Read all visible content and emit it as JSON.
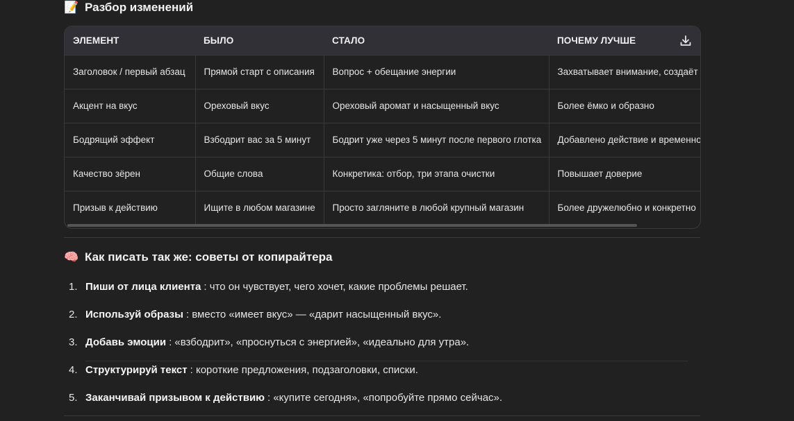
{
  "section1": {
    "emoji": "📝",
    "title": "Разбор изменений"
  },
  "table": {
    "headers": [
      "ЭЛЕМЕНТ",
      "БЫЛО",
      "СТАЛО",
      "ПОЧЕМУ ЛУЧШЕ"
    ],
    "rows": [
      [
        "Заголовок / первый абзац",
        "Прямой старт с описания",
        "Вопрос + обещание энергии",
        "Захватывает внимание, создаёт л"
      ],
      [
        "Акцент на вкус",
        "Ореховый вкус",
        "Ореховый аромат и насыщенный вкус",
        "Более ёмко и образно"
      ],
      [
        "Бодрящий эффект",
        "Взбодрит вас за 5 минут",
        "Бодрит уже через 5 минут после первого глотка",
        "Добавлено действие и временно"
      ],
      [
        "Качество зёрен",
        "Общие слова",
        "Конкретика: отбор, три этапа очистки",
        "Повышает доверие"
      ],
      [
        "Призыв к действию",
        "Ищите в любом магазине",
        "Просто загляните в любой крупный магазин",
        "Более дружелюбно и конкретно"
      ]
    ],
    "download_icon": "download-icon"
  },
  "section2": {
    "emoji": "🧠",
    "title": "Как писать так же: советы от копирайтера"
  },
  "tips": [
    {
      "num": "1.",
      "bold": "Пиши от лица клиента",
      "text": ": что он чувствует, чего хочет, какие проблемы решает."
    },
    {
      "num": "2.",
      "bold": "Используй образы",
      "text": ": вместо «имеет вкус» — «дарит насыщенный вкус»."
    },
    {
      "num": "3.",
      "bold": "Добавь эмоции",
      "text": ": «взбодрит», «проснуться с энергией», «идеально для утра»."
    },
    {
      "num": "4.",
      "bold": "Структурируй текст",
      "text": ": короткие предложения, подзаголовки, списки."
    },
    {
      "num": "5.",
      "bold": "Заканчивай призывом к действию",
      "text": ": «купите сегодня», «попробуйте прямо сейчас»."
    }
  ]
}
